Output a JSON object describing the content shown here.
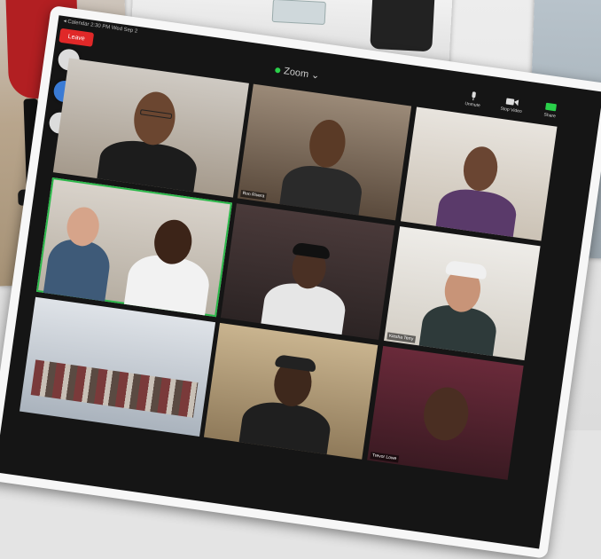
{
  "status_bar": {
    "text": "◂ Calendar  2:30 PM  Wed Sep 2"
  },
  "meeting": {
    "leave_label": "Leave",
    "title": "Zoom",
    "title_chevron": "⌄"
  },
  "controls": [
    {
      "label": "Unmute",
      "icon": "microphone-icon"
    },
    {
      "label": "Stop Video",
      "icon": "video-camera-icon"
    },
    {
      "label": "Share",
      "icon": "share-icon"
    }
  ],
  "participants": [
    {
      "name": "",
      "position": "top-left"
    },
    {
      "name": "Ron Rivera",
      "position": "top-center"
    },
    {
      "name": "",
      "position": "top-right"
    },
    {
      "name": "",
      "position": "middle-left"
    },
    {
      "name": "",
      "position": "middle-center"
    },
    {
      "name": "Kiesha Terry",
      "position": "middle-right"
    },
    {
      "name": "",
      "position": "bottom-left"
    },
    {
      "name": "",
      "position": "bottom-center"
    },
    {
      "name": "Trevor Lowe",
      "position": "bottom-right"
    }
  ],
  "colors": {
    "leave_red": "#e02828",
    "active_speaker": "#2bb84a",
    "zoom_status": "#2ad04a"
  }
}
